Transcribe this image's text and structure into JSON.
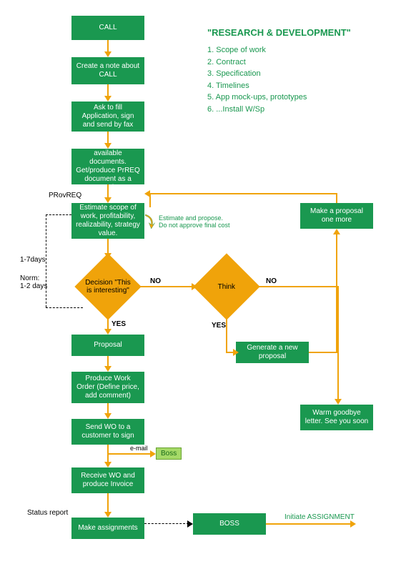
{
  "title": "\"RESEARCH & DEVELOPMENT\"",
  "list_items": [
    "1. Scope of work",
    "2. Contract",
    "3. Specification",
    "4. Timelines",
    "5. App mock-ups, prototypes",
    "6. ...Install W/Sp"
  ],
  "boxes": {
    "call": "CALL",
    "create_note": "Create a note about CALL",
    "ask_fill": "Ask to fill Application, sign and send by fax",
    "request_docs": "Request all available documents. Get/produce PrREQ document as a result.",
    "estimate": "Estimate scope of work, profitability, realizability, strategy value.",
    "proposal": "Proposal",
    "produce_wo": "Produce Work Order (Define price, add comment)",
    "send_wo": "Send WO to a customer to sign",
    "receive_wo": "Receive WO and produce Invoice",
    "make_assign": "Make assignments",
    "make_proposal_more": "Make a proposal one more",
    "generate_new": "Generate a new proposal",
    "warm_goodbye": "Warm goodbye letter. See you soon",
    "boss_large": "BOSS",
    "boss_small": "Boss"
  },
  "diamonds": {
    "decision": "Decision \"This is interesting\"",
    "think": "Think"
  },
  "labels": {
    "provreq": "PRovREQ",
    "estimate_note": "Estimate and propose.\nDo not approve final cost",
    "days_range": "1-7days",
    "norm": "Norm:\n1-2 days",
    "no": "NO",
    "yes": "YES",
    "email": "e-mail",
    "status_report": "Status report",
    "initiate": "Initiate ASSIGNMENT"
  }
}
